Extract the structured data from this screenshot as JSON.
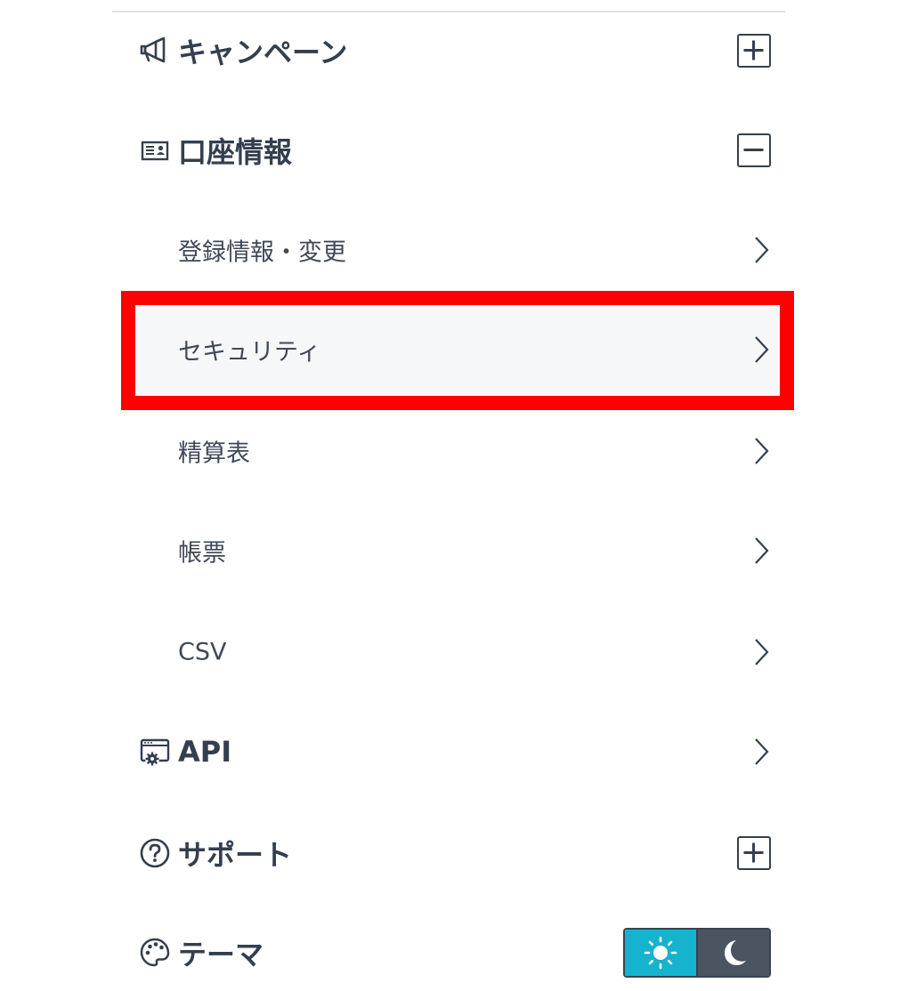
{
  "menu": {
    "campaign": {
      "label": "キャンペーン",
      "icon": "megaphone-icon",
      "toggle": "expand"
    },
    "account": {
      "label": "口座情報",
      "icon": "id-card-icon",
      "toggle": "collapse",
      "items": [
        {
          "label": "登録情報・変更"
        },
        {
          "label": "セキュリティ",
          "highlighted": true
        },
        {
          "label": "精算表"
        },
        {
          "label": "帳票"
        },
        {
          "label": "CSV"
        }
      ]
    },
    "api": {
      "label": "API",
      "icon": "api-settings-icon"
    },
    "support": {
      "label": "サポート",
      "icon": "question-circle-icon",
      "toggle": "expand"
    },
    "theme": {
      "label": "テーマ",
      "icon": "palette-icon",
      "options": [
        "light",
        "dark"
      ],
      "selected": "light"
    }
  },
  "colors": {
    "text": "#343f4e",
    "highlight_border": "#ff0000",
    "highlight_bg": "#f6f7f9",
    "theme_light_active": "#16b3cf",
    "theme_dark": "#4a5561"
  }
}
